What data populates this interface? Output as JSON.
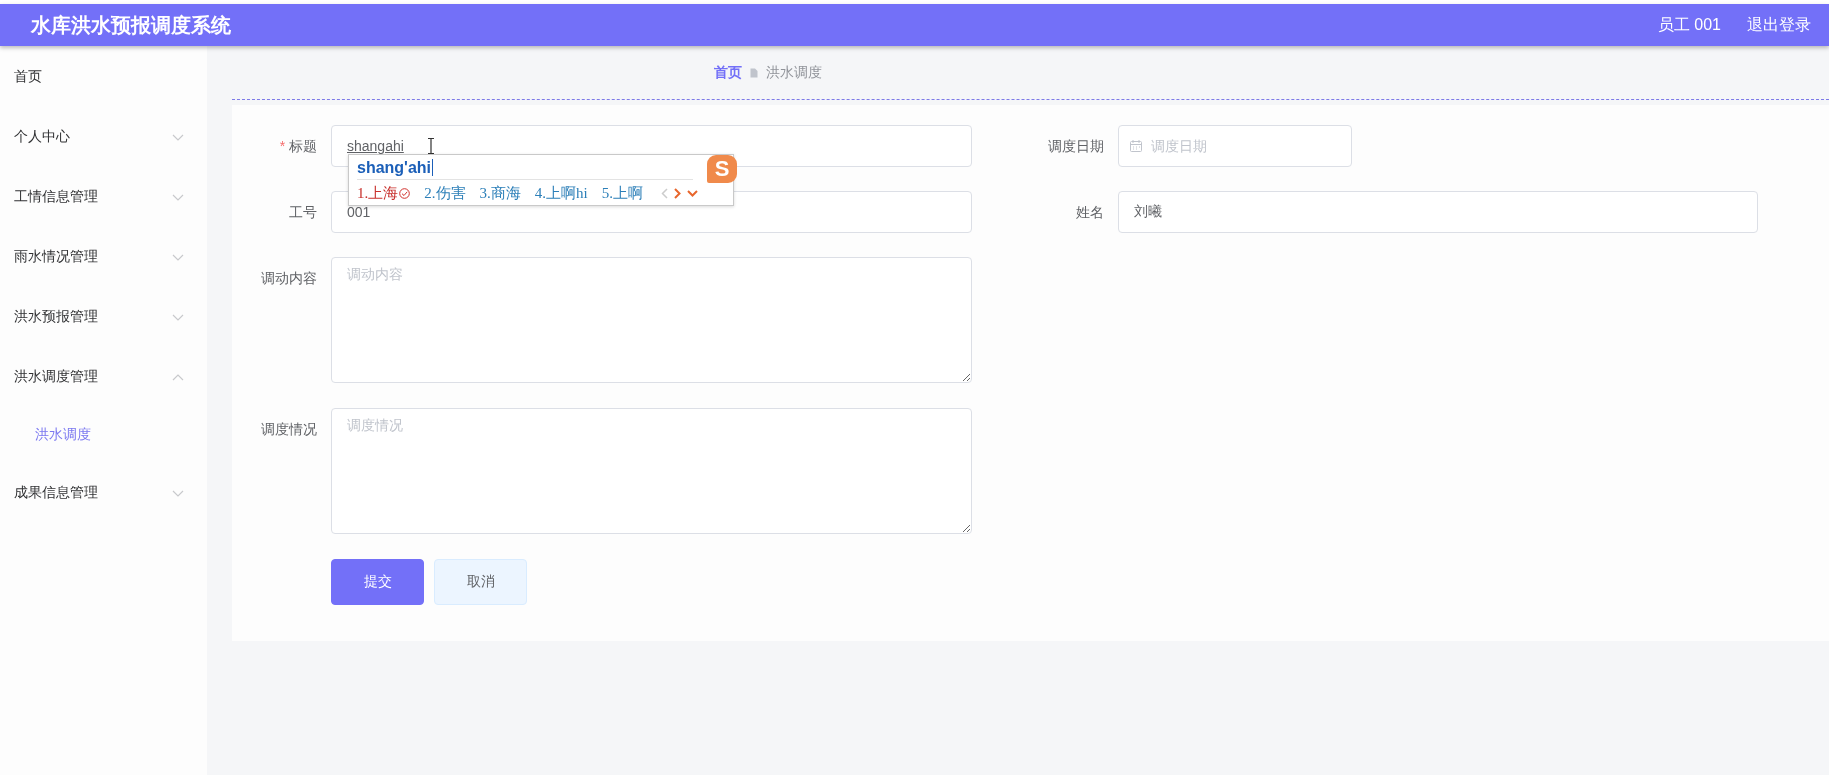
{
  "header": {
    "title": "水库洪水预报调度系统",
    "user": "员工 001",
    "logout": "退出登录"
  },
  "sidebar": {
    "items": [
      {
        "label": "首页",
        "selected": false
      },
      {
        "label": "个人中心",
        "selected": false,
        "expanded": false
      },
      {
        "label": "工情信息管理",
        "selected": false,
        "expanded": false
      },
      {
        "label": "雨水情况管理",
        "selected": false,
        "expanded": false
      },
      {
        "label": "洪水预报管理",
        "selected": false,
        "expanded": false
      },
      {
        "label": "洪水调度管理",
        "selected": false,
        "expanded": true,
        "children": [
          {
            "label": "洪水调度",
            "selected": true
          }
        ]
      },
      {
        "label": "成果信息管理",
        "selected": false,
        "expanded": false
      }
    ]
  },
  "breadcrumb": [
    {
      "label": "首页",
      "current": false
    },
    {
      "label": "洪水调度",
      "current": true
    }
  ],
  "form": {
    "rows": [
      [
        {
          "kind": "text",
          "label": "标题",
          "required": true,
          "required_mark": "*",
          "value": "shangahi"
        },
        {
          "kind": "date",
          "label": "调度日期",
          "placeholder": "调度日期"
        }
      ],
      [
        {
          "kind": "text",
          "label": "工号",
          "value": "001"
        },
        {
          "kind": "text",
          "label": "姓名",
          "value": "刘曦"
        }
      ],
      [
        {
          "kind": "textarea",
          "label": "调动内容",
          "placeholder": "调动内容"
        }
      ],
      [
        {
          "kind": "textarea",
          "label": "调度情况",
          "placeholder": "调度情况"
        }
      ]
    ],
    "buttons": [
      {
        "label": "提交",
        "kind": "primary"
      },
      {
        "label": "取消",
        "kind": "default"
      }
    ]
  },
  "ime": {
    "logo": "S",
    "composition": "shang'ahi",
    "candidates": [
      {
        "label": "1.上海",
        "selected": true
      },
      {
        "label": "2.伤害",
        "selected": false
      },
      {
        "label": "3.商海",
        "selected": false
      },
      {
        "label": "4.上啊hi",
        "selected": false
      },
      {
        "label": "5.上啊",
        "selected": false
      }
    ]
  }
}
